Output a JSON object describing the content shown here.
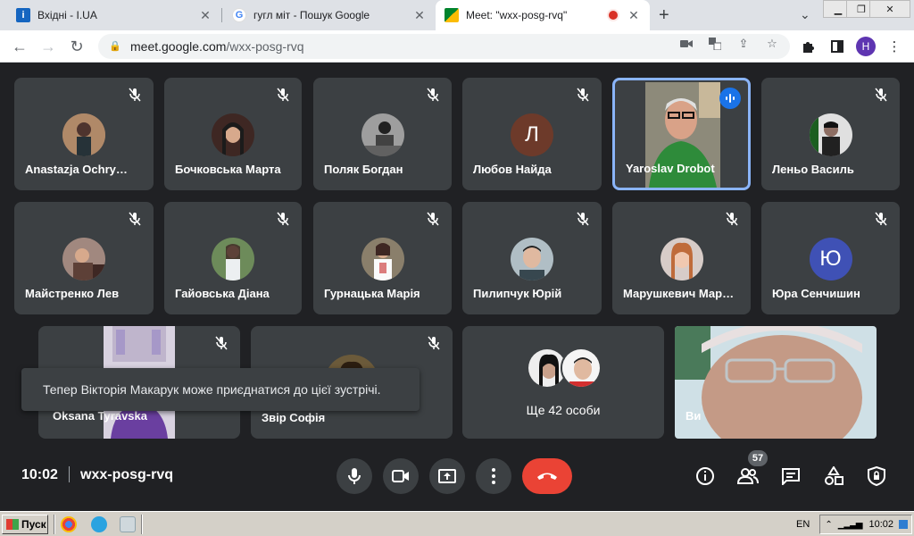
{
  "browser": {
    "tabs": [
      {
        "title": "Вхідні - I.UA",
        "icon": "i-ua-icon"
      },
      {
        "title": "гугл міт - Пошук Google",
        "icon": "google-icon"
      },
      {
        "title": "Meet: \"wxx-posg-rvq\"",
        "icon": "meet-icon",
        "active": true
      }
    ],
    "url_host": "meet.google.com",
    "url_path": "/wxx-posg-rvq",
    "profile_initial": "H"
  },
  "meet": {
    "participants": [
      {
        "name": "Anastazja Ochry…",
        "avatar": "photo",
        "color": "#8d6e63"
      },
      {
        "name": "Бочковська Марта",
        "avatar": "photo",
        "color": "#5d4037"
      },
      {
        "name": "Поляк Богдан",
        "avatar": "photo",
        "color": "#616161"
      },
      {
        "name": "Любов Найда",
        "avatar": "Л",
        "color": "#6d3a2a"
      },
      {
        "name": "Yaroslav Drobot",
        "avatar": "video",
        "color": "#2e7d32"
      },
      {
        "name": "Леньо Василь",
        "avatar": "photo",
        "color": "#424242"
      },
      {
        "name": "Майстренко Лев",
        "avatar": "photo",
        "color": "#795548"
      },
      {
        "name": "Гайовська Діана",
        "avatar": "photo",
        "color": "#6d8b5a"
      },
      {
        "name": "Гурнацька Марія",
        "avatar": "photo",
        "color": "#8a7f6b"
      },
      {
        "name": "Пилипчук Юрій",
        "avatar": "photo",
        "color": "#90a4ae"
      },
      {
        "name": "Марушкевич Мар…",
        "avatar": "photo",
        "color": "#a1887f"
      },
      {
        "name": "Юра Сенчишин",
        "avatar": "Ю",
        "color": "#3f51b5"
      },
      {
        "name": "Oksana Tyravska",
        "avatar": "video",
        "color": "#5c5c7a"
      },
      {
        "name": "Звір Софія",
        "avatar": "photo",
        "color": "#6b5a3a"
      }
    ],
    "more_label": "Ще 42 особи",
    "self_label": "Ви",
    "toast": "Тепер Вікторія Макарук може приєднатися до цієї зустрічі.",
    "time": "10:02",
    "meeting_code": "wxx-posg-rvq",
    "participant_count": "57"
  },
  "taskbar": {
    "start_label": "Пуск",
    "lang": "EN",
    "clock": "10:02"
  }
}
